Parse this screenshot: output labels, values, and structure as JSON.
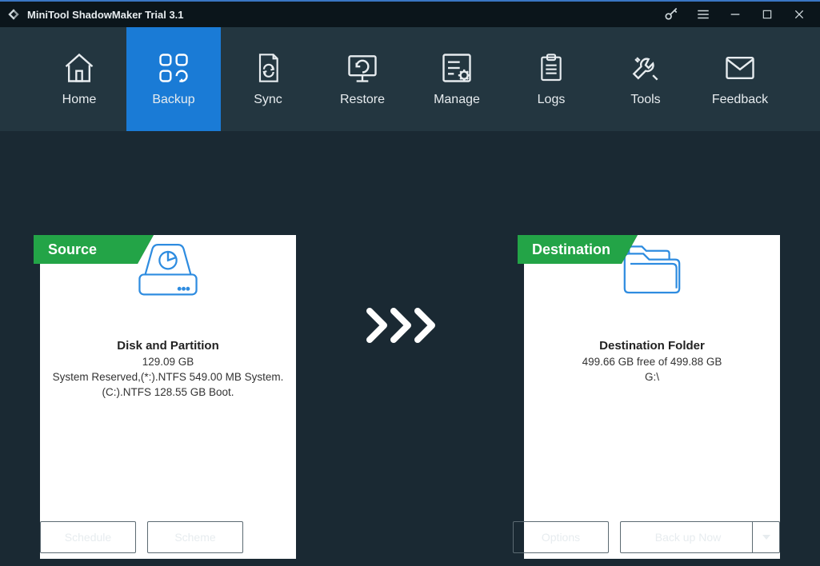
{
  "app": {
    "title": "MiniTool ShadowMaker Trial 3.1"
  },
  "tabs": {
    "home": {
      "label": "Home"
    },
    "backup": {
      "label": "Backup"
    },
    "sync": {
      "label": "Sync"
    },
    "restore": {
      "label": "Restore"
    },
    "manage": {
      "label": "Manage"
    },
    "logs": {
      "label": "Logs"
    },
    "tools": {
      "label": "Tools"
    },
    "feedback": {
      "label": "Feedback"
    }
  },
  "source": {
    "header": "Source",
    "title": "Disk and Partition",
    "size": "129.09 GB",
    "line1": "System Reserved,(*:).NTFS 549.00 MB System.",
    "line2": "(C:).NTFS 128.55 GB Boot."
  },
  "destination": {
    "header": "Destination",
    "title": "Destination Folder",
    "size": "499.66 GB free of 499.88 GB",
    "path": "G:\\"
  },
  "buttons": {
    "schedule": "Schedule",
    "scheme": "Scheme",
    "options": "Options",
    "backup_now": "Back up Now"
  }
}
